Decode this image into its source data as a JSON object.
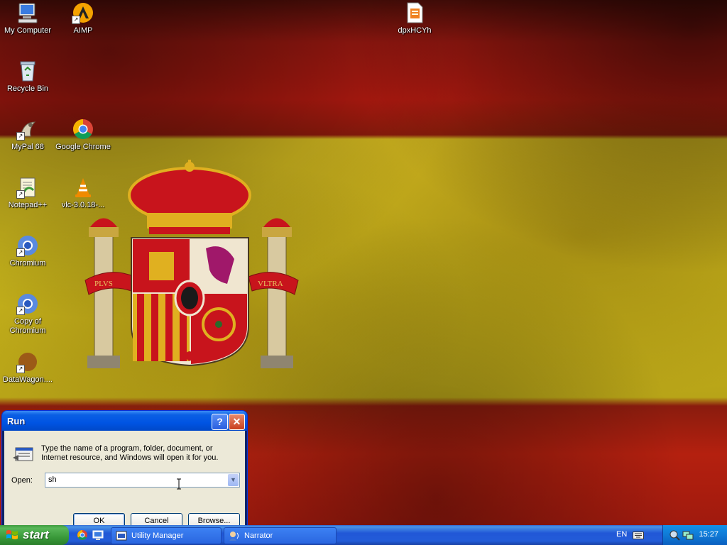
{
  "desktop": {
    "icons": [
      {
        "label": "My Computer",
        "icon": "my-computer-icon"
      },
      {
        "label": "AIMP",
        "icon": "aimp-icon"
      },
      {
        "label": "dpxHCYh",
        "icon": "file-icon"
      },
      {
        "label": "Recycle Bin",
        "icon": "recycle-bin-icon"
      },
      {
        "label": "MyPal 68",
        "icon": "mypal-icon"
      },
      {
        "label": "Google Chrome",
        "icon": "chrome-icon"
      },
      {
        "label": "Notepad++",
        "icon": "notepadpp-icon"
      },
      {
        "label": "vlc-3.0.18-...",
        "icon": "vlc-icon"
      },
      {
        "label": "Chromium",
        "icon": "chromium-icon"
      },
      {
        "label": "Copy of Chromium",
        "icon": "chromium-icon"
      },
      {
        "label": "DataWagon....",
        "icon": "datawagon-icon"
      }
    ],
    "wallpaper_motto": {
      "left": "PLVS",
      "right": "VLTRA"
    }
  },
  "run_dialog": {
    "title": "Run",
    "help_label": "?",
    "close_label": "✕",
    "description": "Type the name of a program, folder, document, or Internet resource, and Windows will open it for you.",
    "open_label": "Open:",
    "open_value": "sh",
    "ok_label": "OK",
    "cancel_label": "Cancel",
    "browse_label": "Browse..."
  },
  "taskbar": {
    "start_label": "start",
    "tasks": [
      {
        "label": "Utility Manager",
        "icon": "utility-manager-icon"
      },
      {
        "label": "Narrator",
        "icon": "narrator-icon"
      }
    ],
    "language": "EN",
    "clock": "15:27"
  },
  "colors": {
    "flag_red": "#b41a10",
    "flag_yellow": "#c9b61c",
    "xp_blue": "#225cd8",
    "start_green": "#3a9a3a"
  }
}
